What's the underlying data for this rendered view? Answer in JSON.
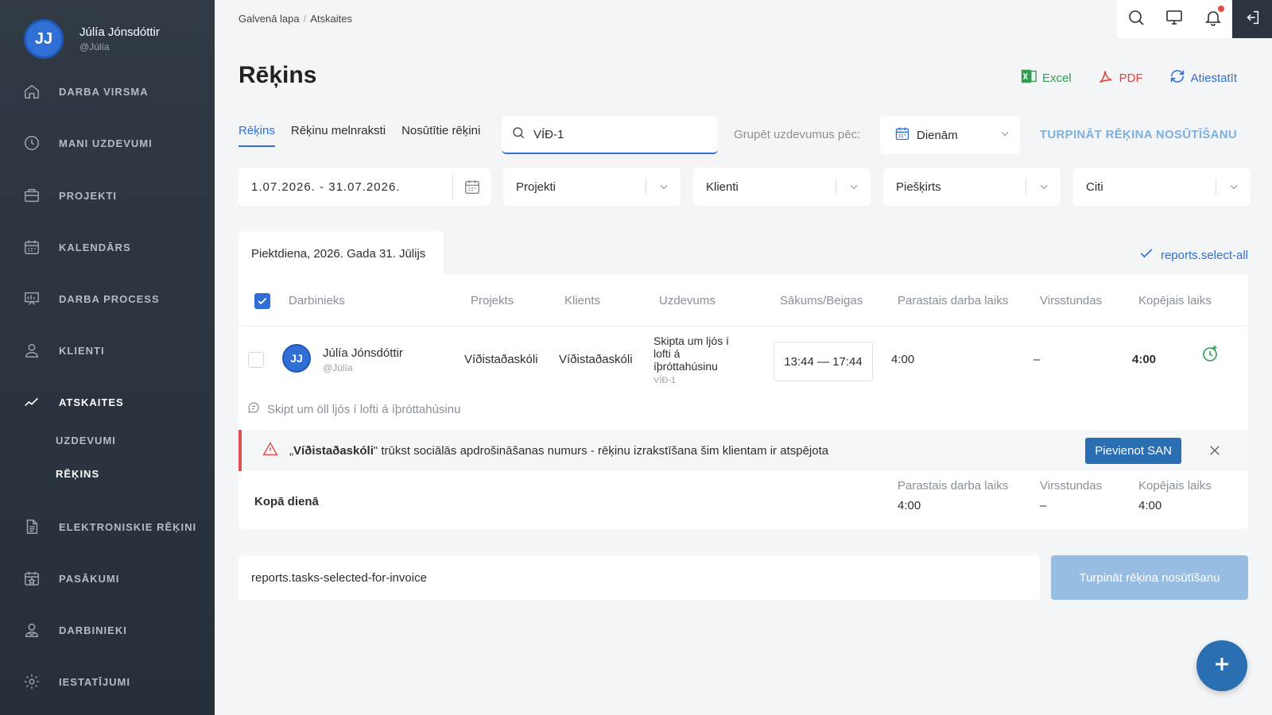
{
  "user": {
    "initials": "JJ",
    "name": "Júlía Jónsdóttir",
    "handle": "@Júlía"
  },
  "sidebar": {
    "items": [
      {
        "label": "DARBA VIRSMA",
        "icon": "home-icon"
      },
      {
        "label": "MANI UZDEVUMI",
        "icon": "clock-icon"
      },
      {
        "label": "PROJEKTI",
        "icon": "briefcase-icon"
      },
      {
        "label": "KALENDĀRS",
        "icon": "calendar-icon"
      },
      {
        "label": "DARBA PROCESS",
        "icon": "board-icon"
      },
      {
        "label": "KLIENTI",
        "icon": "user-icon"
      },
      {
        "label": "ATSKAITES",
        "icon": "chart-line-icon"
      },
      {
        "label": "ELEKTRONISKIE RĒĶINI",
        "icon": "document-icon"
      },
      {
        "label": "PASĀKUMI",
        "icon": "calendar-star-icon"
      },
      {
        "label": "DARBINIEKI",
        "icon": "users-icon"
      },
      {
        "label": "IESTATĪJUMI",
        "icon": "gear-icon"
      }
    ],
    "subitems": [
      {
        "label": "UZDEVUMI"
      },
      {
        "label": "RĒĶINS"
      }
    ]
  },
  "breadcrumb": {
    "home": "Galvenā lapa",
    "current": "Atskaites"
  },
  "page": {
    "title": "Rēķins"
  },
  "actions": {
    "excel": "Excel",
    "pdf": "PDF",
    "reset": "Atiestatīt"
  },
  "tabs": [
    {
      "label": "Rēķins"
    },
    {
      "label": "Rēķinu melnraksti"
    },
    {
      "label": "Nosūtītie rēķini"
    }
  ],
  "search": {
    "value": "VÍÐ-1"
  },
  "group": {
    "label": "Grupēt uzdevumus pēc:",
    "value": "Dienām"
  },
  "continue_link": "TURPINĀT RĒĶINA NOSŪTĪŠANU",
  "filters": {
    "date_range": "1.07.2026. - 31.07.2026.",
    "projects": "Projekti",
    "clients": "Klienti",
    "assigned": "Piešķirts",
    "other": "Citi"
  },
  "day": {
    "tab_label": "Piektdiena, 2026. Gada 31. Jūlijs",
    "select_all": "reports.select-all"
  },
  "table": {
    "headers": [
      "Darbinieks",
      "Projekts",
      "Klients",
      "Uzdevums",
      "Sākums/Beigas",
      "Parastais darba laiks",
      "Virsstundas",
      "Kopējais laiks"
    ],
    "row": {
      "initials": "JJ",
      "name": "Júlía Jónsdóttir",
      "handle": "@Júlía",
      "project": "Víðistaðaskóli",
      "client": "Víðistaðaskóli",
      "task": "Skipta um ljós í lofti á íþróttahúsinu",
      "task_code": "VÍÐ-1",
      "time": "13:44 — 17:44",
      "regular": "4:00",
      "overtime": "–",
      "total": "4:00",
      "comment": "Skipt um öll ljós í lofti á íþróttahúsinu"
    }
  },
  "alert": {
    "quote_open": "„",
    "client": "Víðistaðaskóli",
    "message": "\" trūkst sociālās apdrošināšanas numurs - rēķinu izrakstīšana šim klientam ir atspējota",
    "button": "Pievienot SAN"
  },
  "totals": {
    "label": "Kopā dienā",
    "regular_label": "Parastais darba laiks",
    "regular": "4:00",
    "overtime_label": "Virsstundas",
    "overtime": "–",
    "total_label": "Kopējais laiks",
    "total": "4:00"
  },
  "footer": {
    "selected_text": "reports.tasks-selected-for-invoice",
    "button": "Turpināt rēķina nosūtīšanu"
  },
  "colors": {
    "sidebar": "#2b3540",
    "accent": "#2f6fd6",
    "excel": "#2e9e4f",
    "pdf": "#e0443a",
    "alert": "#e05252"
  }
}
